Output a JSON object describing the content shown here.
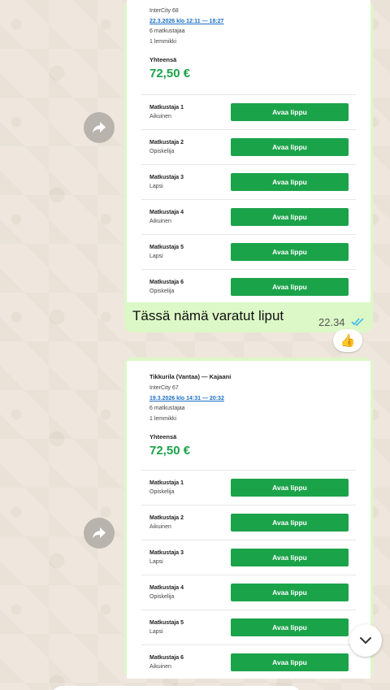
{
  "message1": {
    "train": "InterCity 68",
    "date": "22.3.2026 klo 12:11 — 18:27",
    "travelers": "6 matkustajaa",
    "pets": "1 lemmikki",
    "total_label": "Yhteensä",
    "total_value": "72,50 €",
    "passengers": [
      {
        "label": "Matkustaja 1",
        "type": "Aikuinen",
        "button": "Avaa lippu"
      },
      {
        "label": "Matkustaja 2",
        "type": "Opiskelija",
        "button": "Avaa lippu"
      },
      {
        "label": "Matkustaja 3",
        "type": "Lapsi",
        "button": "Avaa lippu"
      },
      {
        "label": "Matkustaja 4",
        "type": "Aikuinen",
        "button": "Avaa lippu"
      },
      {
        "label": "Matkustaja 5",
        "type": "Lapsi",
        "button": "Avaa lippu"
      },
      {
        "label": "Matkustaja 6",
        "type": "Opiskelija",
        "button": "Avaa lippu"
      }
    ],
    "caption": "Tässä nämä varatut liput",
    "time": "22.34",
    "reaction": "👍"
  },
  "message2": {
    "route": "Tikkurila (Vantaa) — Kajaani",
    "train": "InterCity 67",
    "date": "19.3.2026 klo 14:31 — 20:32",
    "travelers": "6 matkustajaa",
    "pets": "1 lemmikki",
    "total_label": "Yhteensä",
    "total_value": "72,50 €",
    "passengers": [
      {
        "label": "Matkustaja 1",
        "type": "Opiskelija",
        "button": "Avaa lippu"
      },
      {
        "label": "Matkustaja 2",
        "type": "Aikuinen",
        "button": "Avaa lippu"
      },
      {
        "label": "Matkustaja 3",
        "type": "Lapsi",
        "button": "Avaa lippu"
      },
      {
        "label": "Matkustaja 4",
        "type": "Opiskelija",
        "button": "Avaa lippu"
      },
      {
        "label": "Matkustaja 5",
        "type": "Lapsi",
        "button": "Avaa lippu"
      },
      {
        "label": "Matkustaja 6",
        "type": "Aikuinen",
        "button": "Avaa lippu"
      }
    ]
  },
  "icons": {
    "forward": "forward-arrow-icon",
    "read_receipt": "double-check-icon",
    "scroll_down": "chevron-down-icon"
  },
  "colors": {
    "bubble": "#dcf8c6",
    "button_green": "#1ba34a",
    "price_green": "#1ba34a",
    "link_blue": "#1a6fc4",
    "read_tick": "#34b7f1"
  }
}
